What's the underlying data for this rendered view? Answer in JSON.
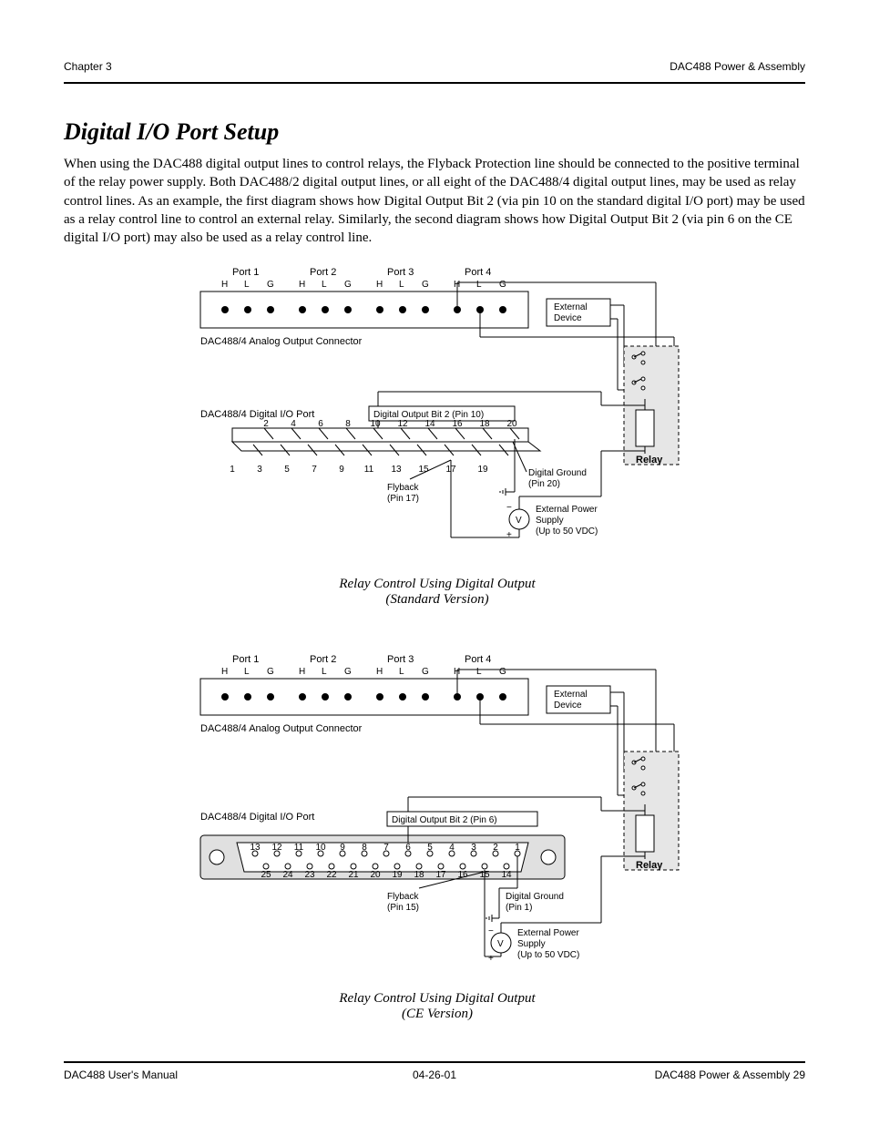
{
  "header": {
    "left": "Chapter 3",
    "right": "DAC488 Power & Assembly"
  },
  "footer": {
    "left": "DAC488 User's Manual",
    "center": "04-26-01",
    "right": "DAC488 Power & Assembly   29"
  },
  "title": "Digital I/O Port Setup",
  "paragraph": "When using the DAC488 digital output lines to control relays, the Flyback Protection line should be connected to the positive terminal of the relay power supply. Both DAC488/2 digital output lines, or all eight of the DAC488/4 digital output lines, may be used as relay control lines. As an example, the first diagram shows how Digital Output Bit 2 (via pin 10 on the standard digital I/O port) may be used as a relay control line to control an external relay. Similarly, the second diagram shows how Digital Output Bit 2 (via pin 6 on the CE digital I/O port) may also be used as a relay control line.",
  "fig1": {
    "ports": [
      "Port 1",
      "Port 2",
      "Port 3",
      "Port 4"
    ],
    "hlg": [
      "H",
      "L",
      "G"
    ],
    "analogLabel": "DAC488/4 Analog Output Connector",
    "digitalPortLabel": "DAC488/4 Digital I/O Port",
    "digOutLabel": "Digital Output Bit 2 (Pin 10)",
    "topPins": [
      "2",
      "4",
      "6",
      "8",
      "10",
      "12",
      "14",
      "16",
      "18",
      "20"
    ],
    "botPins": [
      "1",
      "3",
      "5",
      "7",
      "9",
      "11",
      "13",
      "15",
      "17",
      "19"
    ],
    "flyback": "Flyback\n(Pin 17)",
    "dground": "Digital Ground\n(Pin 20)",
    "eps1": "External Power",
    "eps2": "Supply",
    "eps3": "(Up to 50 VDC)",
    "extDevice": "External\nDevice",
    "relay": "Relay",
    "caption": "Relay Control Using Digital Output\n(Standard Version)"
  },
  "fig2": {
    "ports": [
      "Port 1",
      "Port 2",
      "Port 3",
      "Port 4"
    ],
    "hlg": [
      "H",
      "L",
      "G"
    ],
    "analogLabel": "DAC488/4 Analog Output Connector",
    "digitalPortLabel": "DAC488/4 Digital I/O Port",
    "digOutLabel": "Digital Output Bit 2 (Pin 6)",
    "topRow": [
      "13",
      "12",
      "11",
      "10",
      "9",
      "8",
      "7",
      "6",
      "5",
      "4",
      "3",
      "2",
      "1"
    ],
    "botRow": [
      "25",
      "24",
      "23",
      "22",
      "21",
      "20",
      "19",
      "18",
      "17",
      "16",
      "15",
      "14"
    ],
    "flyback": "Flyback\n(Pin 15)",
    "dground": "Digital Ground\n(Pin 1)",
    "eps1": "External Power",
    "eps2": "Supply",
    "eps3": "(Up to 50 VDC)",
    "extDevice": "External\nDevice",
    "relay": "Relay",
    "caption": "Relay Control Using Digital Output\n(CE Version)"
  }
}
